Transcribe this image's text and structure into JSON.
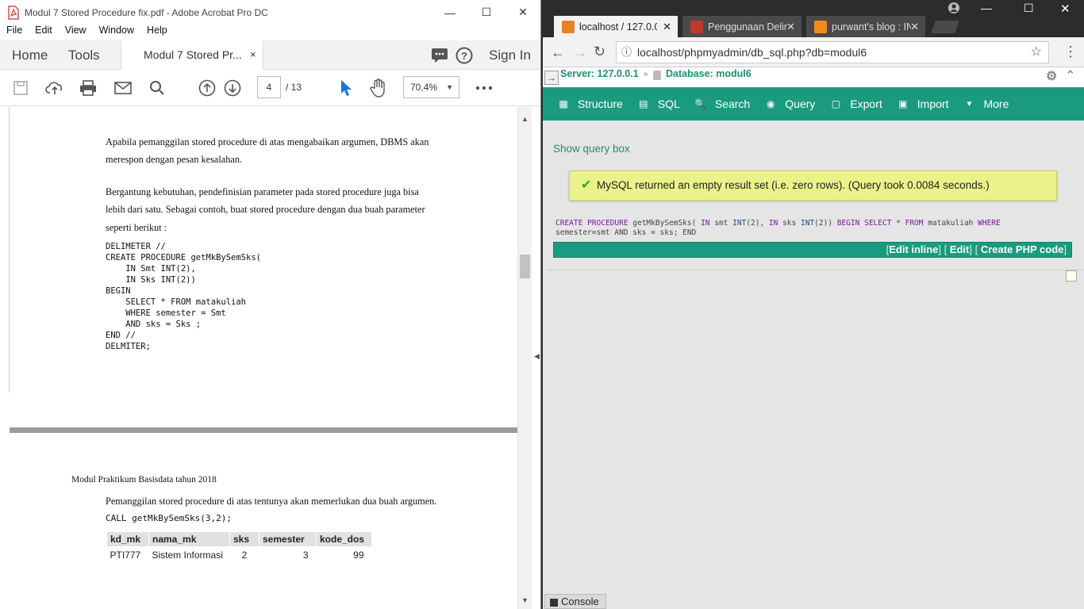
{
  "acrobat": {
    "window_title": "Modul 7 Stored Procedure fix.pdf - Adobe Acrobat Pro DC",
    "menu": [
      "File",
      "Edit",
      "View",
      "Window",
      "Help"
    ],
    "tabs": {
      "home": "Home",
      "tools": "Tools",
      "doc": "Modul 7 Stored Pr...",
      "close": "×",
      "sign_in": "Sign In"
    },
    "toolbar": {
      "page": "4",
      "total": "/ 13",
      "zoom": "70,4%"
    },
    "page1": {
      "para1_line1": "Apabila pemanggilan stored procedure di atas mengabaikan argumen, DBMS akan",
      "para1_line2": "merespon dengan pesan kesalahan.",
      "para2_line1": "Bergantung kebutuhan, pendefinisian parameter pada stored procedure juga bisa",
      "para2_line2": "lebih dari satu. Sebagai contoh, buat stored procedure dengan dua buah parameter",
      "para2_line3": "seperti berikut :",
      "code": "DELIMETER //\nCREATE PROCEDURE getMkBySemSks(\n    IN Smt INT(2),\n    IN Sks INT(2))\nBEGIN\n    SELECT * FROM matakuliah\n    WHERE semester = Smt\n    AND sks = Sks ;\nEND //\nDELMITER;"
    },
    "page2": {
      "header": "Modul Praktikum Basisdata tahun 2018",
      "para": "Pemanggilan stored procedure di atas tentunya akan memerlukan dua buah argumen.",
      "call": "CALL getMkBySemSks(3,2);",
      "table": {
        "headers": [
          "kd_mk",
          "nama_mk",
          "sks",
          "semester",
          "kode_dos"
        ],
        "rows": [
          [
            "PTI777",
            "Sistem Informasi",
            "2",
            "3",
            "99"
          ]
        ]
      }
    }
  },
  "chrome": {
    "tabs": [
      {
        "label": "localhost / 127.0.0",
        "fav_color": "#e8822a"
      },
      {
        "label": "Penggunaan Delim",
        "fav_color": "#c0392b"
      },
      {
        "label": "purwant's blog : IN",
        "fav_color": "#f28c18"
      }
    ],
    "url": "localhost/phpmyadmin/db_sql.php?db=modul6",
    "breadcrumb": {
      "server": "Server: 127.0.0.1",
      "sep": "»",
      "database": "Database: modul6"
    },
    "nav": [
      "Structure",
      "SQL",
      "Search",
      "Query",
      "Export",
      "Import",
      "More"
    ],
    "show_query": "Show query box",
    "message": "MySQL returned an empty result set (i.e. zero rows). (Query took 0.0084 seconds.)",
    "sql_line2": "semester=smt AND sks = sks; END",
    "actions": {
      "edit_inline": "Edit inline",
      "edit": "Edit",
      "create_php": "Create PHP code"
    },
    "console": "Console"
  }
}
